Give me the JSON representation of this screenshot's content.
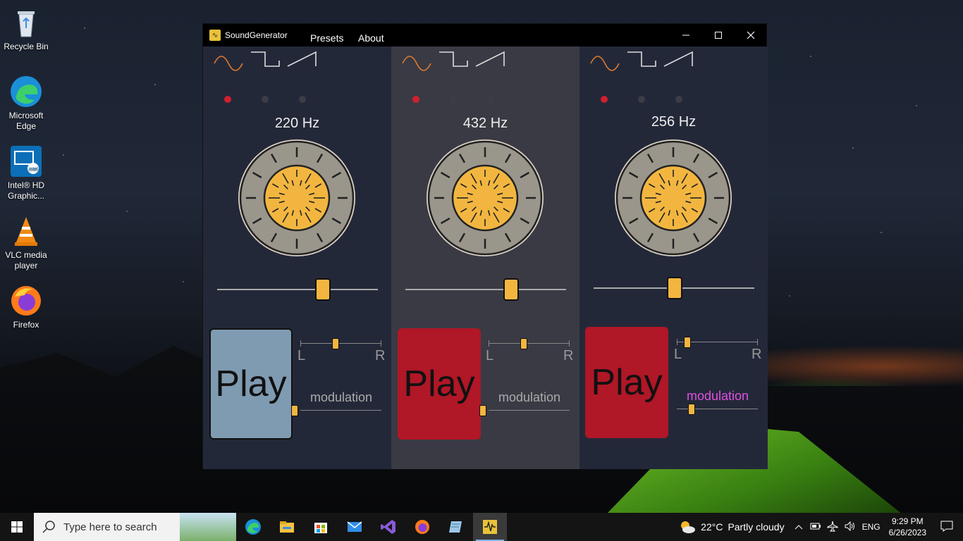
{
  "desktop": {
    "icons": [
      {
        "label_line1": "Recycle Bin",
        "label_line2": ""
      },
      {
        "label_line1": "Microsoft",
        "label_line2": "Edge"
      },
      {
        "label_line1": "Intel® HD",
        "label_line2": "Graphic..."
      },
      {
        "label_line1": "VLC media",
        "label_line2": "player"
      },
      {
        "label_line1": "Firefox",
        "label_line2": ""
      }
    ]
  },
  "window": {
    "title": "SoundGenerator",
    "menu": [
      "Presets",
      "About"
    ],
    "controls": {
      "minimize": "—",
      "maximize": "☐",
      "close": "✕"
    }
  },
  "panels": [
    {
      "frequency": "220 Hz",
      "selected_waveform": "sine",
      "frequency_slider": 0.7,
      "play_label": "Play",
      "play_state": "idle",
      "play_color": "#7f9bb2",
      "balance_left": "L",
      "balance_right": "R",
      "balance": 0.5,
      "modulation_label": "modulation",
      "modulation_color": "#aaaaaa",
      "modulation": 0.0
    },
    {
      "frequency": "432 Hz",
      "selected_waveform": "sine",
      "frequency_slider": 0.7,
      "play_label": "Play",
      "play_state": "playing",
      "play_color": "#b01727",
      "balance_left": "L",
      "balance_right": "R",
      "balance": 0.5,
      "modulation_label": "modulation",
      "modulation_color": "#aaaaaa",
      "modulation": 0.0
    },
    {
      "frequency": "256 Hz",
      "selected_waveform": "sine",
      "frequency_slider": 0.55,
      "play_label": "Play",
      "play_state": "playing",
      "play_color": "#b01727",
      "balance_left": "L",
      "balance_right": "R",
      "balance": 0.2,
      "modulation_label": "modulation",
      "modulation_color": "#e050e0",
      "modulation": 0.25
    }
  ],
  "taskbar": {
    "search_placeholder": "Type here to search",
    "apps": [
      "edge-icon",
      "file-explorer-icon",
      "store-icon",
      "mail-icon",
      "visual-studio-icon",
      "firefox-icon",
      "notepad-icon",
      "soundgenerator-icon"
    ],
    "weather_temp": "22°C",
    "weather_text": "Partly cloudy",
    "language": "ENG",
    "time": "9:29 PM",
    "date": "6/26/2023"
  },
  "colors": {
    "accent_orange": "#f2b640",
    "selected_dot": "#d0202e",
    "unselected_dot": "#3c3c44"
  }
}
